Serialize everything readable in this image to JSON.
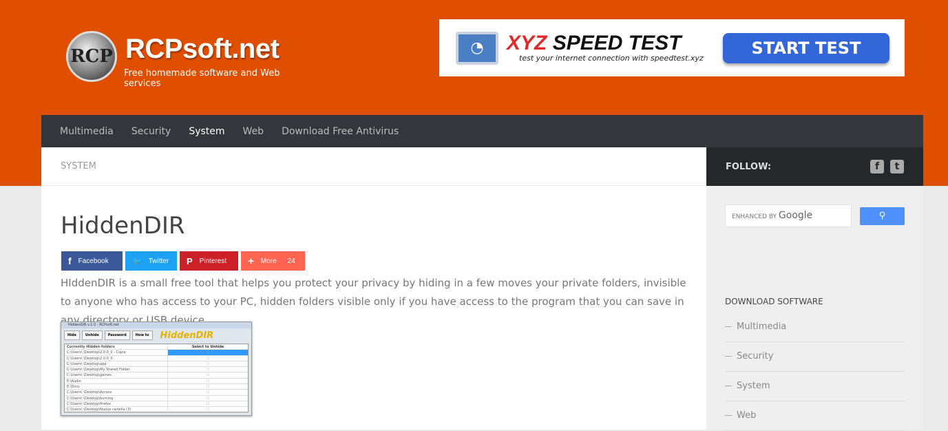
{
  "header": {
    "logo_title": "RCPsoft.net",
    "logo_subtitle": "Free homemade software and Web services",
    "logo_mark": "RCP"
  },
  "ad": {
    "brand_xyz": "XYZ",
    "brand_rest": "SPEED TEST",
    "tagline": "test your internet connection with speedtest.xyz",
    "button": "START TEST"
  },
  "nav": {
    "items": [
      "Multimedia",
      "Security",
      "System",
      "Web",
      "Download Free Antivirus"
    ],
    "active": "System"
  },
  "breadcrumb": "SYSTEM",
  "article": {
    "title": "HiddenDIR",
    "share": [
      {
        "label": "Facebook",
        "icon": "f",
        "color": "#3b5998"
      },
      {
        "label": "Twitter",
        "icon": "🐦",
        "color": "#1da1f2"
      },
      {
        "label": "Pinterest",
        "icon": "P",
        "color": "#cb2027"
      },
      {
        "label": "More",
        "icon": "+",
        "color": "#ff6550",
        "count": "24"
      }
    ],
    "description": "HIddenDIR is a small free tool that helps you protect your privacy by hiding in a few moves your private folders, invisible to anyone who has access to your PC, hidden folders visible only if you have access to the program that you can save in any directory or USB device.",
    "screenshot": {
      "window_title": "HiddenDIR v.1.0 - RCPsoft.net",
      "buttons": [
        "Hide",
        "Unhide",
        "Password",
        "How to"
      ],
      "logo": "HiddenDIR",
      "col1": "Currently Hidden folders",
      "col2": "Select to Unhide",
      "rows": [
        "C:\\Users\\ \\Desktop\\2.0.0_0 - Copia",
        "C:\\Users\\ \\Desktop\\2.0.0_0",
        "C:\\Users\\ \\Desktop\\app",
        "C:\\Users\\ \\Desktop\\My Shared Folder",
        "C:\\Users\\ \\Desktop\\games",
        "E:\\Audio",
        "E:\\Docs",
        "C:\\Users\\ \\Desktop\\Access",
        "C:\\Users\\ \\Desktop\\burning",
        "C:\\Users\\ \\Desktop\\firefox",
        "C:\\Users\\ \\Desktop\\Nuova cartella (3)"
      ]
    }
  },
  "sidebar": {
    "follow": "FOLLOW:",
    "search_placeholder_small": "ENHANCED BY",
    "search_placeholder_brand": "Google",
    "download_heading": "DOWNLOAD SOFTWARE",
    "links": [
      "Multimedia",
      "Security",
      "System",
      "Web"
    ]
  },
  "colors": {
    "brand_orange": "#e04e00",
    "nav_bg": "#33363b"
  }
}
